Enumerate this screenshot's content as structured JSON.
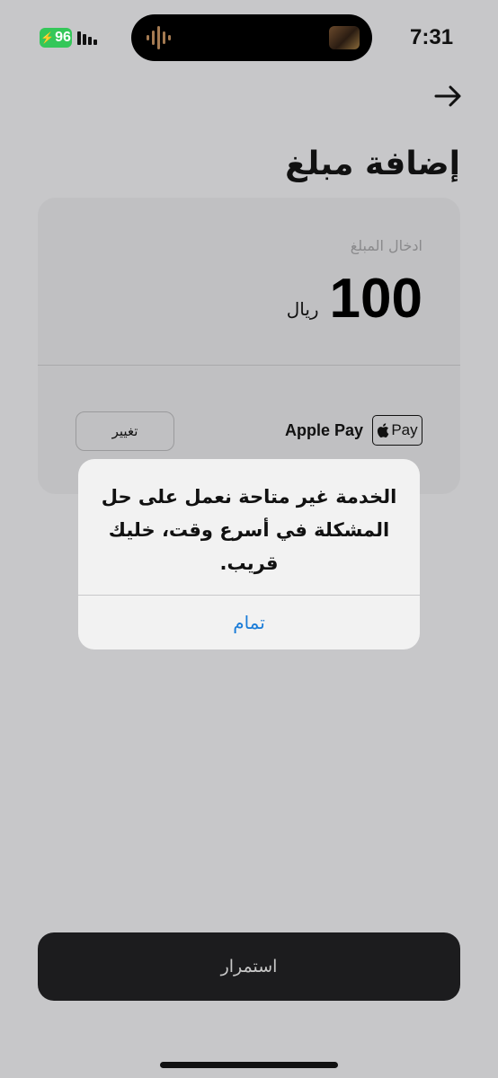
{
  "status_bar": {
    "time": "7:31",
    "battery": "96",
    "icons": [
      "battery-charging-icon",
      "signal-bars-icon",
      "audio-waveform-icon"
    ]
  },
  "nav": {
    "back_icon": "arrow-right-icon"
  },
  "page": {
    "title": "إضافة مبلغ"
  },
  "amount": {
    "label": "ادخال المبلغ",
    "value": "100",
    "currency": "ريال"
  },
  "payment": {
    "method": "Apple Pay",
    "badge_text": "Pay",
    "change_label": "تغيير"
  },
  "alert": {
    "message": "الخدمة غير متاحة نعمل على حل المشكلة في أسرع وقت، خليك قريب.",
    "ok_label": "تمام"
  },
  "footer": {
    "continue_label": "استمرار"
  },
  "colors": {
    "background": "#c7c7c9",
    "accent": "#1a7cd8",
    "battery": "#34c759",
    "primary_button": "#1c1c1e"
  }
}
